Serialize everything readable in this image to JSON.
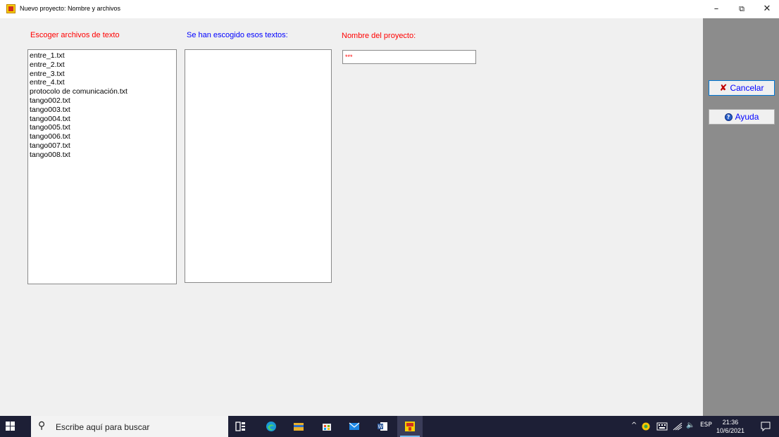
{
  "window": {
    "title": "Nuevo proyecto: Nombre y archivos",
    "controls": {
      "minimize": "–",
      "restore": "⧉",
      "close": "✕"
    }
  },
  "left_panel": {
    "label": "Escoger archivos de texto",
    "files": [
      "entre_1.txt",
      "entre_2.txt",
      "entre_3.txt",
      "entre_4.txt",
      "protocolo de comunicación.txt",
      "tango002.txt",
      "tango003.txt",
      "tango004.txt",
      "tango005.txt",
      "tango006.txt",
      "tango007.txt",
      "tango008.txt"
    ]
  },
  "middle_panel": {
    "label": "Se han escogido esos textos:",
    "files": []
  },
  "project": {
    "label": "Nombre del proyecto:",
    "value": "***"
  },
  "side_buttons": {
    "cancel_label": "Cancelar",
    "help_label": "Ayuda"
  },
  "taskbar": {
    "search_placeholder": "Escribe aquí para buscar",
    "language": "ESP",
    "time": "21:36",
    "date": "10/6/2021",
    "apps": [
      "task-view-icon",
      "edge-icon",
      "file-explorer-icon",
      "store-icon",
      "mail-icon",
      "word-icon",
      "app-icon"
    ]
  },
  "colors": {
    "label_red": "#ff0000",
    "label_blue": "#0000ff",
    "side_panel": "#8c8c8c",
    "taskbar": "#1d1f36"
  }
}
